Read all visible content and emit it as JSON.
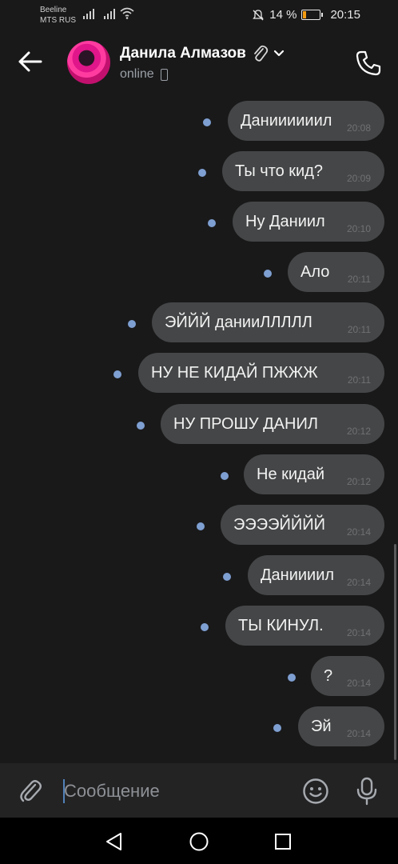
{
  "status_bar": {
    "carrier_1": "Beeline",
    "carrier_2": "MTS RUS",
    "battery_text": "14 %",
    "time": "20:15",
    "icons": [
      "signal-icon",
      "signal-icon",
      "wifi-icon",
      "mute-icon",
      "battery-icon"
    ]
  },
  "header": {
    "contact_name": "Данила Алмазов",
    "status": "online",
    "icons": [
      "back-arrow-icon",
      "paperclip-icon",
      "chevron-down-icon",
      "mobile-icon",
      "phone-icon"
    ]
  },
  "messages": [
    {
      "text": "Даниииииил",
      "time": "20:08"
    },
    {
      "text": "Ты что кид?",
      "time": "20:09"
    },
    {
      "text": "Ну Даниил",
      "time": "20:10"
    },
    {
      "text": "Ало",
      "time": "20:11"
    },
    {
      "text": "ЭЙЙЙ данииЛЛЛЛЛ",
      "time": "20:11"
    },
    {
      "text": "НУ НЕ КИДАЙ ПЖЖЖ",
      "time": "20:11"
    },
    {
      "text": "НУ ПРОШУ ДАНИЛ",
      "time": "20:12"
    },
    {
      "text": "Не кидай",
      "time": "20:12"
    },
    {
      "text": "ЭЭЭЭЙЙЙЙ",
      "time": "20:14"
    },
    {
      "text": "Даниииил",
      "time": "20:14"
    },
    {
      "text": "ТЫ КИНУЛ.",
      "time": "20:14"
    },
    {
      "text": "?",
      "time": "20:14"
    },
    {
      "text": "Эй",
      "time": "20:14"
    }
  ],
  "composer": {
    "placeholder": "Сообщение",
    "icons": [
      "attach-icon",
      "sticker-icon",
      "microphone-icon"
    ]
  },
  "navbar": {
    "icons": [
      "nav-back-icon",
      "nav-home-icon",
      "nav-recents-icon"
    ]
  },
  "colors": {
    "background": "#19191a",
    "bubble": "#454647",
    "unread_dot": "#7e9fd1",
    "caret": "#5181b8"
  }
}
